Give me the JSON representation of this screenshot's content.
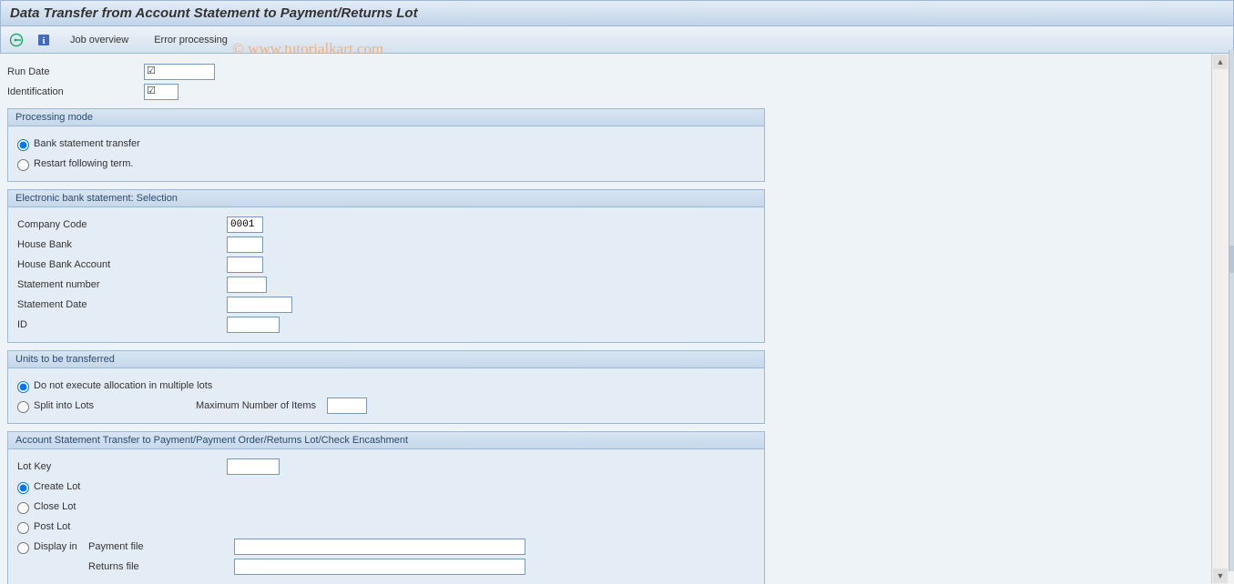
{
  "title": "Data Transfer from Account Statement to Payment/Returns Lot",
  "toolbar": {
    "job_overview": "Job overview",
    "error_processing": "Error processing"
  },
  "watermark": "© www.tutorialkart.com",
  "header": {
    "run_date_label": "Run Date",
    "run_date_value": "",
    "identification_label": "Identification",
    "identification_value": ""
  },
  "processing_mode": {
    "title": "Processing mode",
    "opt1": "Bank statement transfer",
    "opt2": "Restart following term."
  },
  "ebs": {
    "title": "Electronic bank statement: Selection",
    "company_code_label": "Company Code",
    "company_code_value": "0001",
    "house_bank_label": "House Bank",
    "house_bank_value": "",
    "house_bank_account_label": "House Bank Account",
    "house_bank_account_value": "",
    "statement_number_label": "Statement number",
    "statement_number_value": "",
    "statement_date_label": "Statement Date",
    "statement_date_value": "",
    "id_label": "ID",
    "id_value": ""
  },
  "units": {
    "title": "Units to be transferred",
    "opt1": "Do not execute allocation in multiple lots",
    "opt2": "Split into Lots",
    "max_label": "Maximum Number of Items",
    "max_value": ""
  },
  "transfer": {
    "title": "Account Statement Transfer to Payment/Payment Order/Returns Lot/Check Encashment",
    "lot_key_label": "Lot Key",
    "lot_key_value": "",
    "opt_create": "Create Lot",
    "opt_close": "Close Lot",
    "opt_post": "Post Lot",
    "opt_display": "Display in",
    "payment_file_label": "Payment file",
    "payment_file_value": "",
    "returns_file_label": "Returns file",
    "returns_file_value": ""
  }
}
